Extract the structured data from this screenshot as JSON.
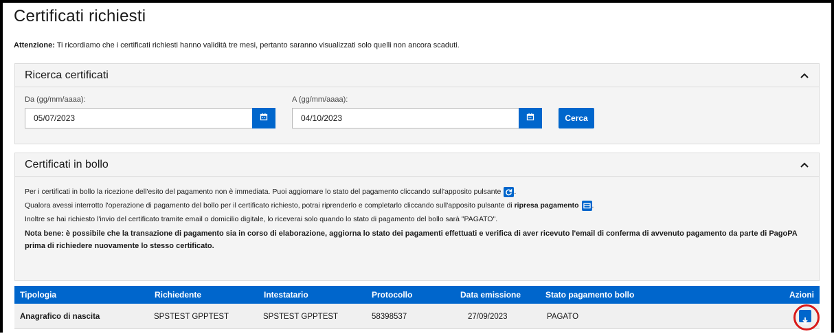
{
  "page": {
    "title": "Certificati richiesti",
    "notice_bold": "Attenzione:",
    "notice_text": " Ti ricordiamo che i certificati richiesti hanno validità tre mesi, pertanto saranno visualizzati solo quelli non ancora scaduti."
  },
  "search_panel": {
    "title": "Ricerca certificati",
    "from_label": "Da (gg/mm/aaaa):",
    "from_value": "05/07/2023",
    "to_label": "A (gg/mm/aaaa):",
    "to_value": "04/10/2023",
    "search_button": "Cerca"
  },
  "bollo_panel": {
    "title": "Certificati in bollo",
    "line1": "Per i certificati in bollo la ricezione dell'esito del pagamento non è immediata. Puoi aggiornare lo stato del pagamento cliccando sull'apposito pulsante",
    "line2_pre": "Qualora avessi interrotto l'operazione di pagamento del bollo per il certificato richiesto, potrai riprenderlo e completarlo cliccando sull'apposito pulsante di ",
    "line2_bold": "ripresa pagamento",
    "line3": "Inoltre se hai richiesto l'invio del certificato tramite email o domicilio digitale, lo riceverai solo quando lo stato di pagamento del bollo sarà \"PAGATO\".",
    "nota": "Nota bene: è possibile che la transazione di pagamento sia in corso di elaborazione, aggiorna lo stato dei pagamenti effettuati e verifica di aver ricevuto l'email di conferma di avvenuto pagamento da parte di PagoPA prima di richiedere nuovamente lo stesso certificato."
  },
  "table": {
    "columns": [
      "Tipologia",
      "Richiedente",
      "Intestatario",
      "Protocollo",
      "Data emissione",
      "Stato pagamento bollo",
      "Azioni"
    ],
    "rows": [
      {
        "tipologia": "Anagrafico di nascita",
        "richiedente": "SPSTEST GPPTEST",
        "intestatario": "SPSTEST GPPTEST",
        "protocollo": "58398537",
        "data_emissione": "27/09/2023",
        "stato": "PAGATO"
      }
    ]
  },
  "colors": {
    "primary": "#0066cc",
    "highlight": "#d91a1a"
  },
  "icons": [
    "chevron-up-icon",
    "calendar-icon",
    "refresh-icon",
    "payment-card-icon",
    "download-icon"
  ]
}
